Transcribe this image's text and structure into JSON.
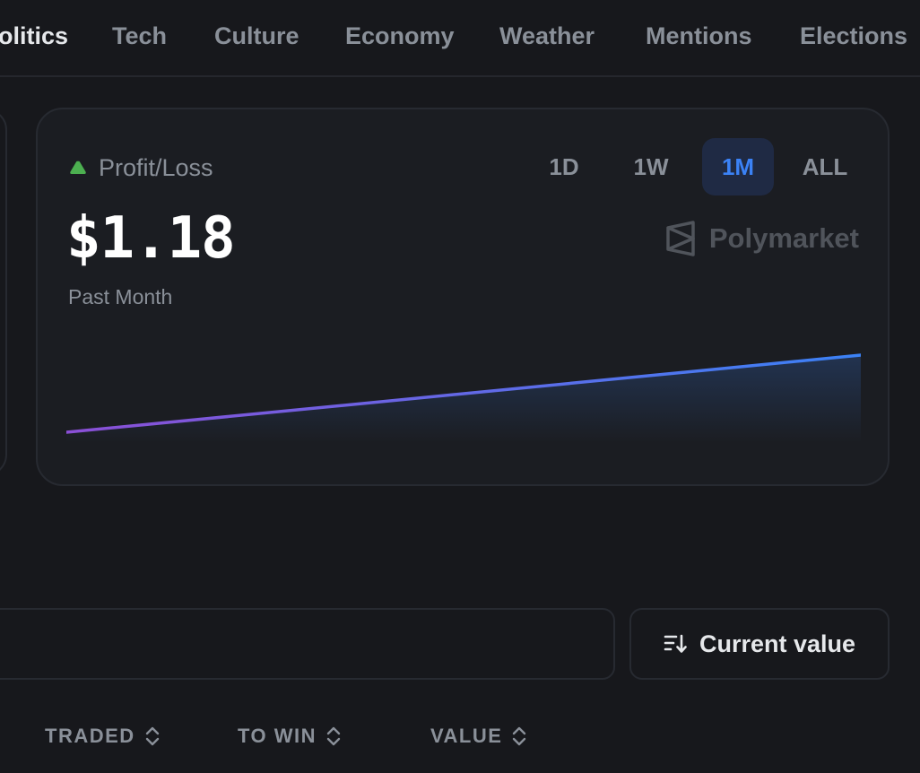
{
  "nav": {
    "items": [
      {
        "label": "olitics",
        "active": true
      },
      {
        "label": "Tech",
        "active": false
      },
      {
        "label": "Culture",
        "active": false
      },
      {
        "label": "Economy",
        "active": false
      },
      {
        "label": "Weather",
        "active": false
      },
      {
        "label": "Mentions",
        "active": false
      },
      {
        "label": "Elections",
        "active": false
      }
    ]
  },
  "pnl": {
    "title": "Profit/Loss",
    "trend_icon": "triangle-up-icon",
    "value": "$1.18",
    "period": "Past Month",
    "brand": "Polymarket",
    "ranges": [
      {
        "label": "1D",
        "active": false
      },
      {
        "label": "1W",
        "active": false
      },
      {
        "label": "1M",
        "active": true
      },
      {
        "label": "ALL",
        "active": false
      }
    ],
    "colors": {
      "positive": "#4caf50",
      "line_start": "#8b4fd6",
      "line_end": "#3b82f6",
      "active_tab_bg": "#1f2a44",
      "active_tab_text": "#3b82f6"
    },
    "series": [
      0,
      1.18
    ]
  },
  "positions": {
    "search_placeholder": "",
    "sort_label": "Current value",
    "columns": [
      {
        "label": "TRADED"
      },
      {
        "label": "TO WIN"
      },
      {
        "label": "VALUE"
      }
    ]
  }
}
